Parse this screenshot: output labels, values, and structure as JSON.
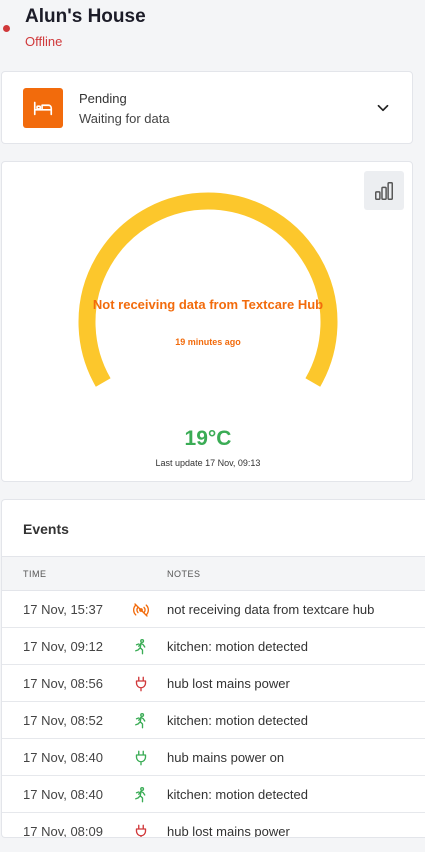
{
  "colors": {
    "accent_orange": "#f26b0c",
    "gauge_yellow": "#fcc72c",
    "status_red": "#d0393b",
    "ok_green": "#3aac55"
  },
  "header": {
    "house_name": "Alun's House",
    "status": "Offline"
  },
  "pending": {
    "icon": "bed-icon",
    "title": "Pending",
    "subtitle": "Waiting for data"
  },
  "gauge": {
    "message": "Not receiving data from Textcare Hub",
    "ago": "19 minutes ago",
    "temperature": "19°C",
    "last_update": "Last update 17 Nov, 09:13"
  },
  "events": {
    "title": "Events",
    "columns": [
      "TIME",
      "NOTES"
    ],
    "rows": [
      {
        "time": "17 Nov, 15:37",
        "icon": "no-signal-icon",
        "icon_color": "#f26b0c",
        "note": "not receiving data from textcare hub"
      },
      {
        "time": "17 Nov, 09:12",
        "icon": "motion-icon",
        "icon_color": "#3aac55",
        "note": "kitchen: motion detected"
      },
      {
        "time": "17 Nov, 08:56",
        "icon": "plug-icon",
        "icon_color": "#d0393b",
        "note": "hub lost mains power"
      },
      {
        "time": "17 Nov, 08:52",
        "icon": "motion-icon",
        "icon_color": "#3aac55",
        "note": "kitchen: motion detected"
      },
      {
        "time": "17 Nov, 08:40",
        "icon": "plug-icon",
        "icon_color": "#3aac55",
        "note": "hub mains power on"
      },
      {
        "time": "17 Nov, 08:40",
        "icon": "motion-icon",
        "icon_color": "#3aac55",
        "note": "kitchen: motion detected"
      },
      {
        "time": "17 Nov, 08:09",
        "icon": "plug-icon",
        "icon_color": "#d0393b",
        "note": "hub lost mains power"
      }
    ]
  }
}
